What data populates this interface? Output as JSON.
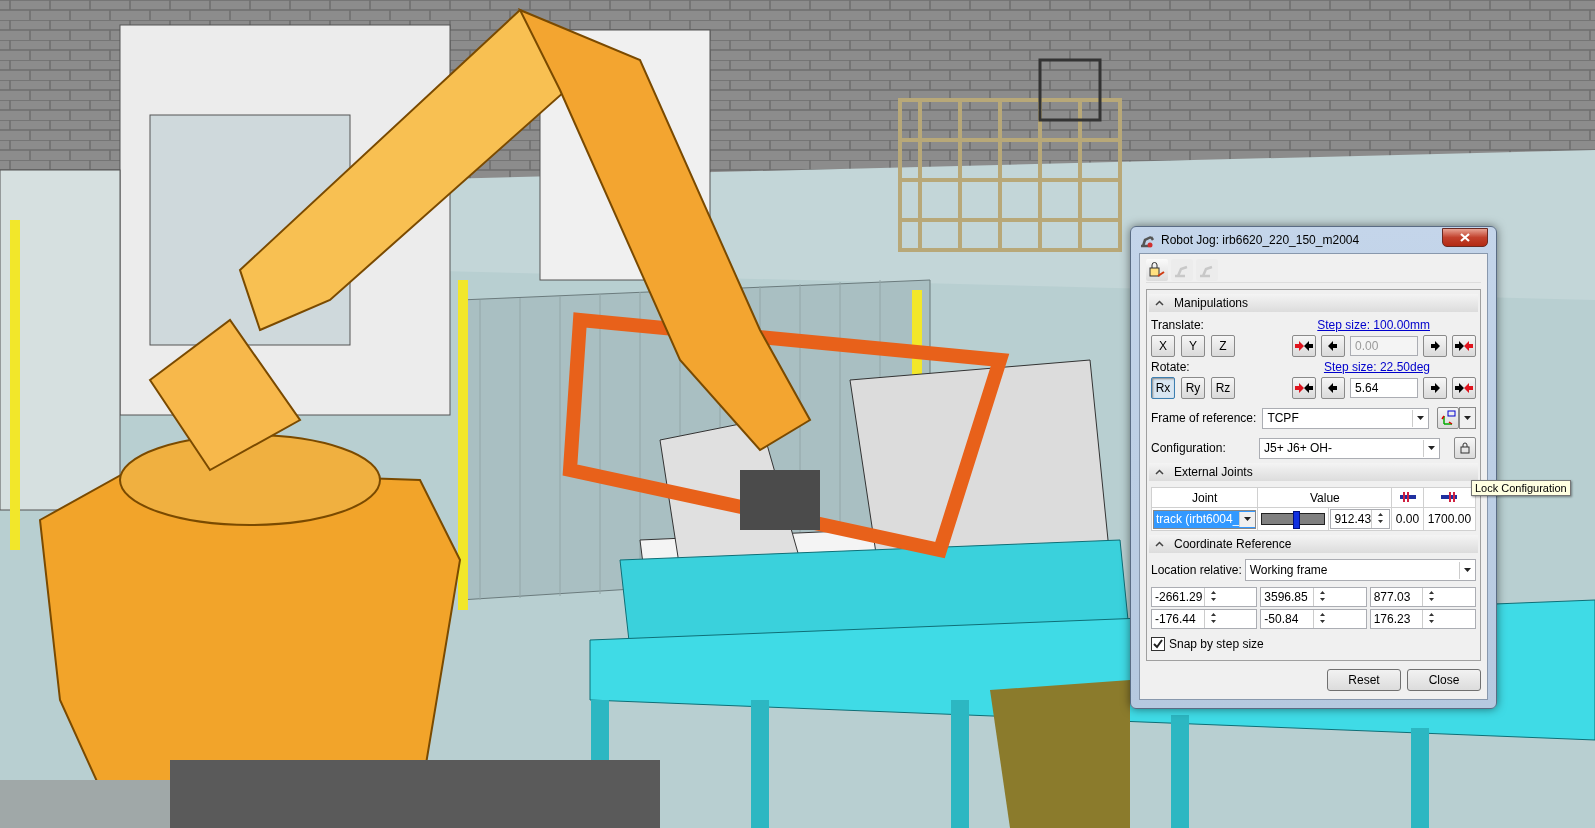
{
  "window": {
    "title": "Robot Jog: irb6620_220_150_m2004"
  },
  "toolbar_buttons": [
    {
      "disabled": false
    },
    {
      "disabled": true
    },
    {
      "disabled": true
    }
  ],
  "manipulations": {
    "title": "Manipulations",
    "translate": {
      "label": "Translate:",
      "step_link": "Step size: 100.00mm",
      "value": "0.00",
      "disabled": true,
      "axes": [
        {
          "label": "X",
          "selected": false
        },
        {
          "label": "Y",
          "selected": false
        },
        {
          "label": "Z",
          "selected": false
        }
      ]
    },
    "rotate": {
      "label": "Rotate:",
      "step_link": "Step size: 22.50deg",
      "value": "5.64",
      "disabled": false,
      "axes": [
        {
          "label": "Rx",
          "selected": true
        },
        {
          "label": "Ry",
          "selected": false
        },
        {
          "label": "Rz",
          "selected": false
        }
      ]
    },
    "frame": {
      "label": "Frame of reference:",
      "value": "TCPF"
    },
    "configuration": {
      "label": "Configuration:",
      "value": "J5+ J6+ OH-"
    }
  },
  "tooltip": "Lock Configuration",
  "external_joints": {
    "title": "External Joints",
    "columns": [
      "Joint",
      "Value"
    ],
    "rows": [
      {
        "joint": "track (irbt6004_",
        "level": 0.54,
        "value": "912.43",
        "min": "0.00",
        "max": "1700.00"
      }
    ]
  },
  "coordinate_reference": {
    "title": "Coordinate Reference",
    "label": "Location relative:",
    "value": "Working frame",
    "fields": [
      [
        "-2661.29",
        "3596.85",
        "877.03"
      ],
      [
        "-176.44",
        "-50.84",
        "176.23"
      ]
    ]
  },
  "snap": {
    "label": "Snap by step size",
    "checked": true
  },
  "buttons": [
    "Reset",
    "Close"
  ]
}
